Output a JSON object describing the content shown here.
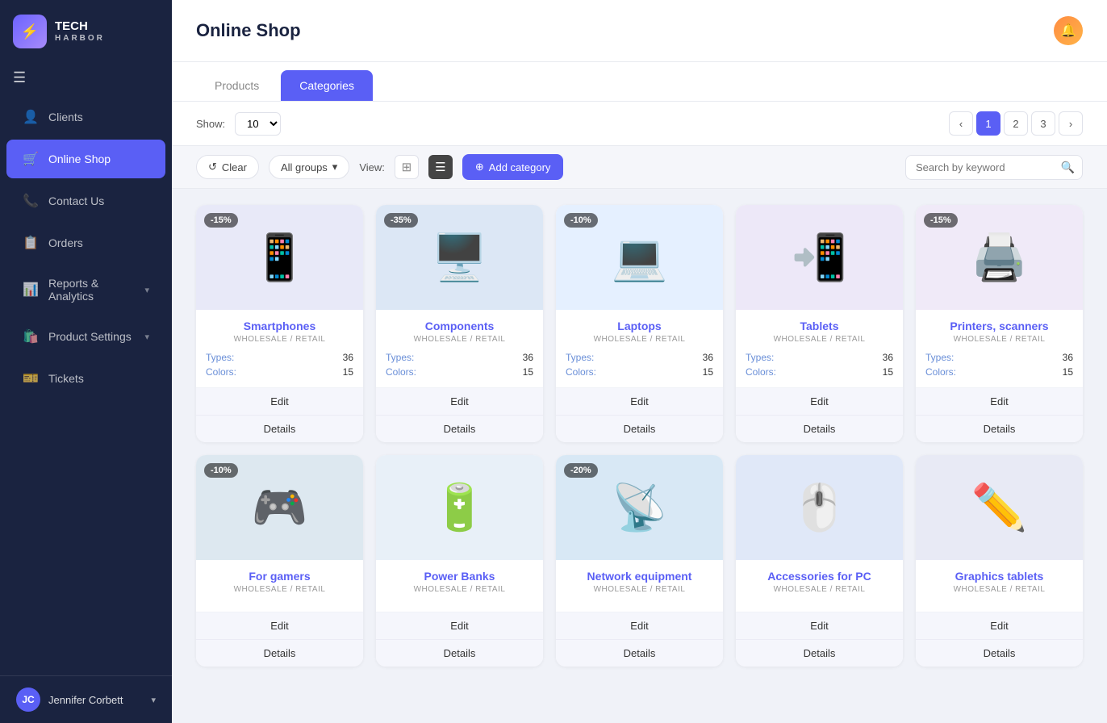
{
  "app": {
    "name": "TECH HARBOR",
    "subtitle": "HARBOR"
  },
  "sidebar": {
    "hamburger": "☰",
    "items": [
      {
        "id": "clients",
        "label": "Clients",
        "icon": "👤",
        "active": false
      },
      {
        "id": "online-shop",
        "label": "Online Shop",
        "icon": "🛒",
        "active": true
      },
      {
        "id": "contact-us",
        "label": "Contact Us",
        "icon": "📞",
        "active": false
      },
      {
        "id": "orders",
        "label": "Orders",
        "icon": "📋",
        "active": false
      },
      {
        "id": "reports",
        "label": "Reports & Analytics",
        "icon": "📊",
        "active": false,
        "arrow": true
      },
      {
        "id": "product-settings",
        "label": "Product Settings",
        "icon": "🛍️",
        "active": false,
        "arrow": true
      },
      {
        "id": "tickets",
        "label": "Tickets",
        "icon": "🎫",
        "active": false
      }
    ],
    "footer": {
      "initials": "JC",
      "name": "Jennifer Corbett",
      "arrow": "▾"
    }
  },
  "header": {
    "title": "Online Shop",
    "bell_icon": "🔔"
  },
  "tabs": [
    {
      "id": "products",
      "label": "Products",
      "active": false
    },
    {
      "id": "categories",
      "label": "Categories",
      "active": true
    }
  ],
  "toolbar": {
    "show_label": "Show:",
    "show_value": "10",
    "pagination": {
      "prev": "‹",
      "pages": [
        "1",
        "2",
        "3"
      ],
      "next": "›",
      "active_page": "1"
    }
  },
  "filter_bar": {
    "clear_label": "Clear",
    "clear_icon": "↺",
    "groups_label": "All groups",
    "view_label": "View:",
    "grid_icon": "⊞",
    "list_icon": "☰",
    "add_category_label": "Add category",
    "add_icon": "⊕",
    "search_placeholder": "Search by keyword"
  },
  "categories": [
    {
      "id": "smartphones",
      "title": "Smartphones",
      "subtitle": "WHOLESALE / RETAIL",
      "badge": "-15%",
      "types": 36,
      "colors": 15,
      "emoji": "📱",
      "edit_label": "Edit",
      "details_label": "Details"
    },
    {
      "id": "components",
      "title": "Components",
      "subtitle": "WHOLESALE / RETAIL",
      "badge": "-35%",
      "types": 36,
      "colors": 15,
      "emoji": "🖥️",
      "edit_label": "Edit",
      "details_label": "Details"
    },
    {
      "id": "laptops",
      "title": "Laptops",
      "subtitle": "WHOLESALE / RETAIL",
      "badge": "-10%",
      "types": 36,
      "colors": 15,
      "emoji": "💻",
      "edit_label": "Edit",
      "details_label": "Details"
    },
    {
      "id": "tablets",
      "title": "Tablets",
      "subtitle": "WHOLESALE / RETAIL",
      "badge": null,
      "types": 36,
      "colors": 15,
      "emoji": "📲",
      "edit_label": "Edit",
      "details_label": "Details"
    },
    {
      "id": "printers",
      "title": "Printers, scanners",
      "subtitle": "WHOLESALE / RETAIL",
      "badge": "-15%",
      "types": 36,
      "colors": 15,
      "emoji": "🖨️",
      "edit_label": "Edit",
      "details_label": "Details"
    },
    {
      "id": "gamers",
      "title": "For gamers",
      "subtitle": "WHOLESALE / RETAIL",
      "badge": "-10%",
      "types": null,
      "colors": null,
      "emoji": "🎮",
      "edit_label": "Edit",
      "details_label": "Details"
    },
    {
      "id": "power-banks",
      "title": "Power Banks",
      "subtitle": "WHOLESALE / RETAIL",
      "badge": null,
      "types": null,
      "colors": null,
      "emoji": "🔋",
      "edit_label": "Edit",
      "details_label": "Details"
    },
    {
      "id": "network",
      "title": "Network equipment",
      "subtitle": "WHOLESALE / RETAIL",
      "badge": "-20%",
      "types": null,
      "colors": null,
      "emoji": "📡",
      "edit_label": "Edit",
      "details_label": "Details"
    },
    {
      "id": "accessories-pc",
      "title": "Accessories for PC",
      "subtitle": "WHOLESALE / RETAIL",
      "badge": null,
      "types": null,
      "colors": null,
      "emoji": "🖱️",
      "edit_label": "Edit",
      "details_label": "Details"
    },
    {
      "id": "graphics-tablets",
      "title": "Graphics tablets",
      "subtitle": "WHOLESALE / RETAIL",
      "badge": null,
      "types": null,
      "colors": null,
      "emoji": "✏️",
      "edit_label": "Edit",
      "details_label": "Details"
    }
  ],
  "stat_labels": {
    "types": "Types:",
    "colors": "Colors:"
  }
}
